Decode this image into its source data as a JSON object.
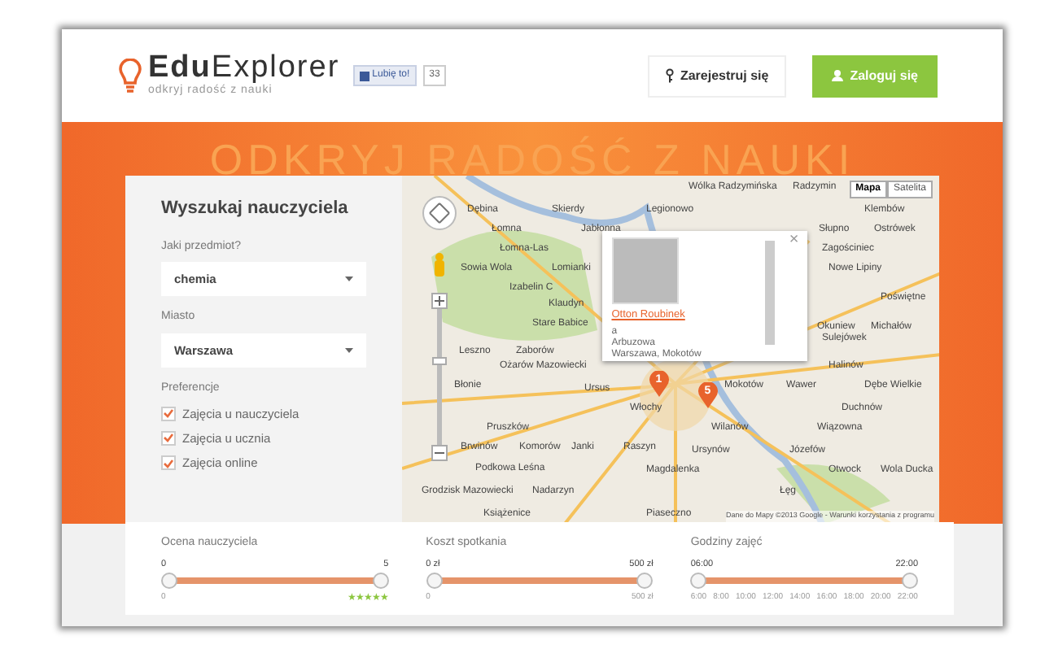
{
  "header": {
    "logo": {
      "brand_bold": "Edu",
      "brand_rest": "Explorer",
      "tagline": "odkryj radość z nauki"
    },
    "like": {
      "label": "Lubię to!",
      "count": "33"
    },
    "buttons": [
      {
        "kind": "register",
        "label": "Zarejestruj się"
      },
      {
        "kind": "login",
        "label": "Zaloguj się"
      }
    ]
  },
  "hero": {
    "headline": "ODKRYJ RADOŚĆ Z NAUKI"
  },
  "search": {
    "title": "Wyszukaj nauczyciela",
    "fields": [
      {
        "label": "Jaki przedmiot?",
        "value": "chemia"
      },
      {
        "label": "Miasto",
        "value": "Warszawa"
      }
    ],
    "preferences_label": "Preferencje",
    "preferences": [
      {
        "label": "Zajęcia u nauczyciela",
        "checked": true
      },
      {
        "label": "Zajęcia u ucznia",
        "checked": true
      },
      {
        "label": "Zajęcia online",
        "checked": true
      }
    ]
  },
  "map": {
    "map_types": [
      {
        "label": "Mapa",
        "selected": true
      },
      {
        "label": "Satelita",
        "selected": false
      }
    ],
    "places": [
      "Wólka Radzymińska",
      "Radzymin",
      "Dębina",
      "Skierdy",
      "Legionowo",
      "Klembów",
      "Łomna",
      "Jabłonna",
      "Słupno",
      "Ostrówek",
      "Łomna-Las",
      "Zagościniec",
      "Sowia Wola",
      "Lomianki",
      "Nowe Lipiny",
      "Izabelin C",
      "Poświętne",
      "Klaudyn",
      "Stare Babice",
      "Okuniew",
      "Michałów",
      "Sulejówek",
      "Leszno",
      "Zaborów",
      "Ożarów Mazowiecki",
      "Halinów",
      "Błonie",
      "Ursus",
      "Mokotów",
      "Wawer",
      "Dębe Wielkie",
      "Włochy",
      "Duchnów",
      "Pruszków",
      "Wilanów",
      "Wiązowna",
      "Brwinów",
      "Komorów",
      "Janki",
      "Raszyn",
      "Ursynów",
      "Józefów",
      "Podkowa Leśna",
      "Magdalenka",
      "Otwock",
      "Wola Ducka",
      "Grodzisk Mazowiecki",
      "Nadarzyn",
      "Łęg",
      "Książenice",
      "Piaseczno"
    ],
    "copyright": "Dane do Mapy ©2013 Google - Warunki korzystania z programu",
    "markers": [
      "1",
      "5"
    ],
    "popup": {
      "name": "Otton Roubinek",
      "line_1": "a",
      "line_2": "Arbuzowa",
      "line_3": "Warszawa, Mokotów",
      "close": "×"
    }
  },
  "filters": [
    {
      "label": "Ocena nauczyciela",
      "low": "0",
      "high": "5",
      "thumbs": [
        {
          "level": 0
        },
        {
          "level": 1
        }
      ],
      "min": "0",
      "stars": 5
    },
    {
      "label": "Koszt spotkania",
      "low": "0 zł",
      "high": "500 zł",
      "thumbs": [
        {
          "level": 0
        },
        {
          "level": 1
        }
      ],
      "min": "0",
      "max": "500 zł"
    },
    {
      "label": "Godziny zajęć",
      "low": "06:00",
      "high": "22:00",
      "thumbs": [
        {
          "level": 0
        },
        {
          "level": 1
        }
      ],
      "ticks": [
        "6:00",
        "8:00",
        "10:00",
        "12:00",
        "14:00",
        "16:00",
        "18:00",
        "20:00",
        "22:00"
      ]
    }
  ]
}
